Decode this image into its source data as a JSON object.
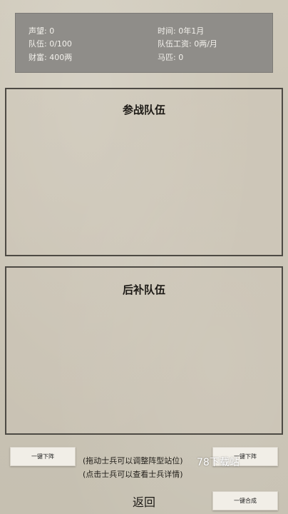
{
  "stats": {
    "reputation_label": "声望:",
    "reputation_value": "0",
    "team_label": "队伍:",
    "team_value": "0/100",
    "wealth_label": "财富:",
    "wealth_value": "400两",
    "time_label": "时间:",
    "time_value": "0年1月",
    "salary_label": "队伍工资:",
    "salary_value": "0两/月",
    "horses_label": "马匹:",
    "horses_value": "0"
  },
  "battle_team": {
    "title": "参战队伍"
  },
  "reserve_team": {
    "title": "后补队伍"
  },
  "buttons": {
    "unassign_all": "一键下阵",
    "right_top": "一键下阵",
    "merge_all": "一键合成"
  },
  "hints": {
    "drag": "(拖动士兵可以调整阵型站位)",
    "click": "(点击士兵可以查看士兵详情)"
  },
  "footer": {
    "back": "返回"
  },
  "watermark": "78下载站"
}
